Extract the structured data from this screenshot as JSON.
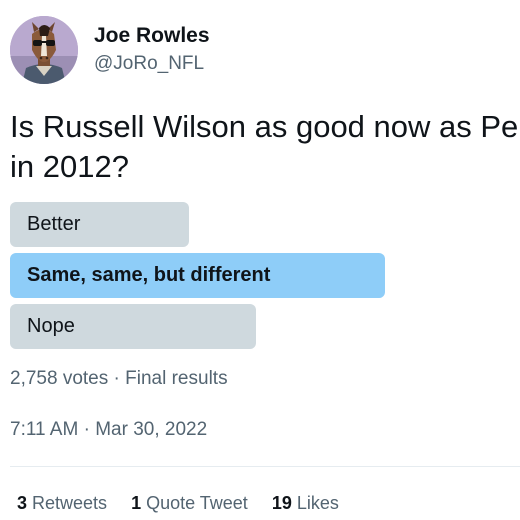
{
  "author": {
    "display_name": "Joe Rowles",
    "handle": "@JoRo_NFL",
    "avatar_icon": "horse-character-avatar"
  },
  "tweet": {
    "text_line1": "Is Russell Wilson as good now as Pe",
    "text_line2": "in 2012?"
  },
  "poll": {
    "options": [
      {
        "label": "Better",
        "share": 0.32,
        "winner": false
      },
      {
        "label": "Same, same, but different",
        "share": 0.67,
        "winner": true
      },
      {
        "label": "Nope",
        "share": 0.44,
        "winner": false
      }
    ],
    "votes": "2,758 votes",
    "separator": "·",
    "status": "Final results"
  },
  "timestamp": {
    "time": "7:11 AM",
    "separator": "·",
    "date": "Mar 30, 2022"
  },
  "stats": [
    {
      "count": "3",
      "label": "Retweets"
    },
    {
      "count": "1",
      "label": "Quote Tweet"
    },
    {
      "count": "19",
      "label": "Likes"
    }
  ],
  "colors": {
    "poll_winner": "#8ecdf8",
    "poll_other": "#cfd9de",
    "secondary_text": "#536471",
    "primary_text": "#0f1419"
  }
}
